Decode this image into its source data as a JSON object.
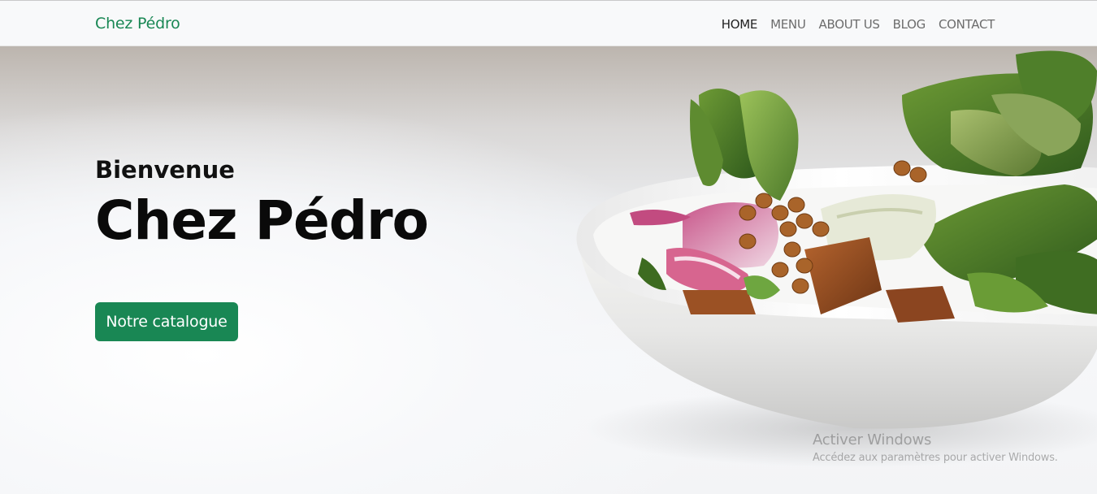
{
  "navbar": {
    "brand": "Chez Pédro",
    "links": [
      {
        "label": "HOME",
        "active": true
      },
      {
        "label": "MENU",
        "active": false
      },
      {
        "label": "ABOUT US",
        "active": false
      },
      {
        "label": "BLOG",
        "active": false
      },
      {
        "label": "CONTACT",
        "active": false
      }
    ]
  },
  "hero": {
    "welcome": "Bienvenue",
    "title": "Chez Pédro",
    "cta_label": "Notre catalogue",
    "image_icon": "salad-bowl-photo"
  },
  "watermark": {
    "title": "Activer Windows",
    "subtitle": "Accédez aux paramètres pour activer Windows."
  },
  "colors": {
    "brand": "#198754",
    "nav_bg": "#f8f9fa",
    "text_dark": "#0a0a0a",
    "nav_text": "#6c6c6c"
  }
}
